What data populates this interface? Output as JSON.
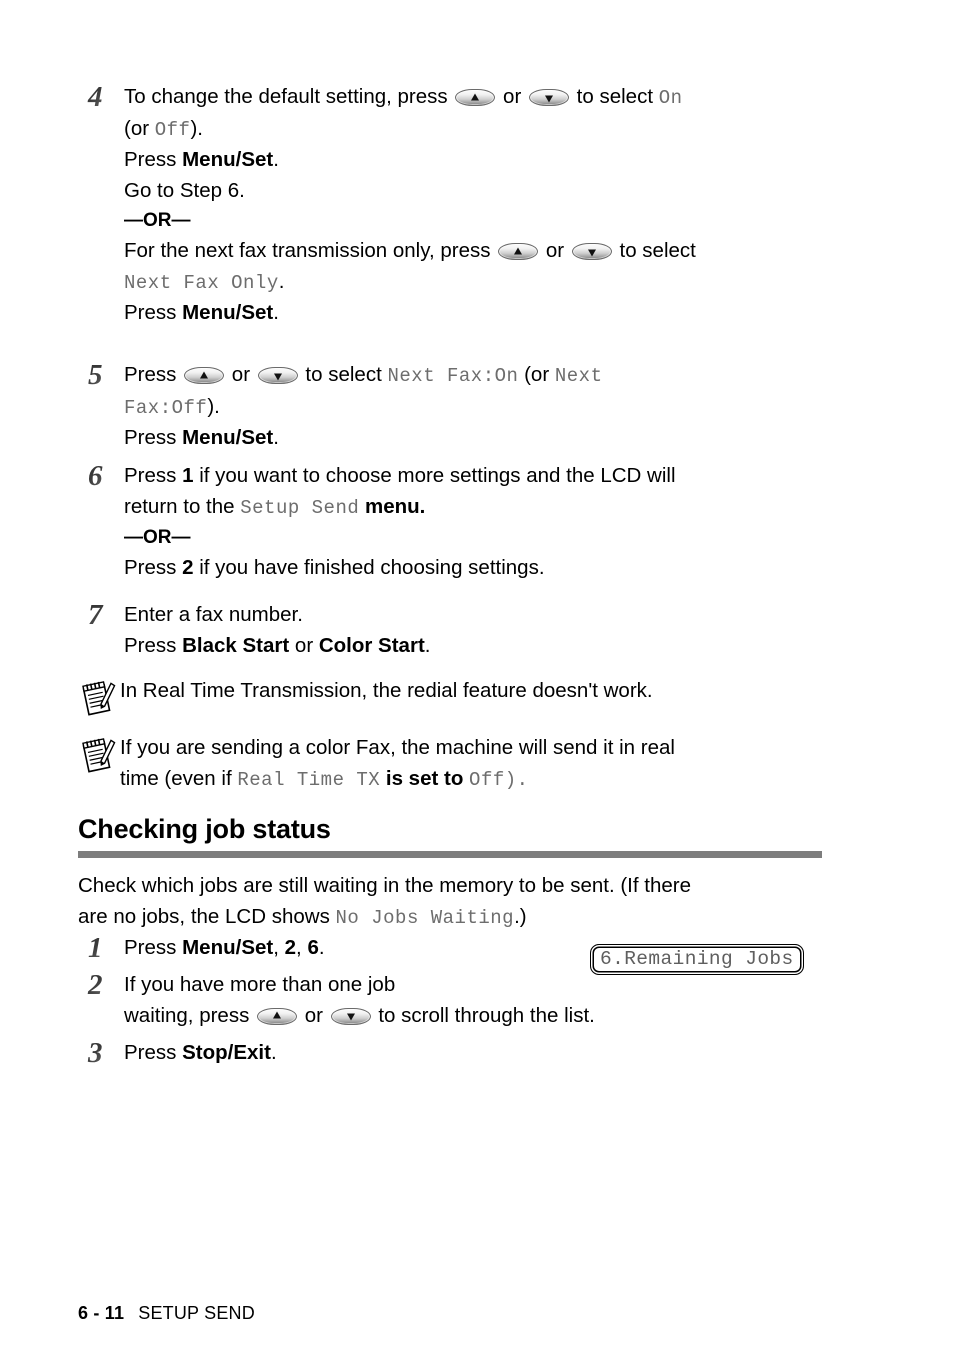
{
  "steps": [
    {
      "number": "4",
      "lines": [
        {
          "id": "s4l1",
          "pre": "To change the default setting, press ",
          "key1": "up",
          "mid": " or ",
          "key2": "down",
          "post": " to select ",
          "lcd_tail": "On"
        },
        {
          "id": "s4l2",
          "pre": "(or ",
          "lcd_mid": "Off",
          "post": ")."
        },
        {
          "id": "s4l3",
          "pre": "Press ",
          "bold": "Menu/Set",
          "post": "."
        },
        {
          "id": "s4l4",
          "pre": "Go to Step 6."
        },
        {
          "id": "s4or",
          "or_label": "—OR—"
        },
        {
          "id": "s4l5",
          "pre": "For the next fax transmission only, press ",
          "key1": "up",
          "mid": " or ",
          "key2": "down",
          "post": " to select"
        },
        {
          "id": "s4l6",
          "lcd_lead": "Next Fax Only",
          "post": "."
        },
        {
          "id": "s4l7",
          "pre": "Press ",
          "bold": "Menu/Set",
          "post": "."
        }
      ]
    },
    {
      "number": "5",
      "lines": [
        {
          "id": "s5l1",
          "pre": "Press ",
          "key1": "up",
          "mid": " or ",
          "key2": "down",
          "post": " to select ",
          "lcd_a": "Next Fax:On",
          "between": " (or ",
          "lcd_b": "Next"
        },
        {
          "id": "s5l2",
          "lcd_lead": "Fax:Off",
          "post": ")."
        },
        {
          "id": "s5l3",
          "pre": "Press ",
          "bold": "Menu/Set",
          "post": "."
        }
      ]
    },
    {
      "number": "6",
      "lines": [
        {
          "id": "s6l1",
          "pre": "Press ",
          "bold": "1",
          "post": " if you want to choose more settings and the LCD will"
        },
        {
          "id": "s6l2",
          "pre": "return to the ",
          "lcd_mid": "Setup Send",
          "bold_post": " menu."
        },
        {
          "id": "s6or",
          "or_label": "—OR—"
        },
        {
          "id": "s6l3",
          "pre": "Press ",
          "bold": "2",
          "post": " if you have finished choosing settings."
        }
      ]
    },
    {
      "number": "7",
      "lines": [
        {
          "id": "s7l1",
          "pre": "Enter a fax number."
        },
        {
          "id": "s7l2",
          "pre": "Press ",
          "bold": "Black Start",
          "mid_plain": " or ",
          "bold2": "Color Start",
          "post": "."
        }
      ]
    }
  ],
  "notes": [
    {
      "id": "note1",
      "icon": "notepad-pencil-icon",
      "text": "In Real Time Transmission, the redial feature doesn't work."
    },
    {
      "id": "note2",
      "icon": "notepad-pencil-icon",
      "line1_pre": "If you are sending a color Fax, the machine will send it in real",
      "line2_pre": "time (even if ",
      "line2_lcd": "Real Time TX",
      "line2_mid": " is set to ",
      "line2_lcd2": "Off",
      "line2_post": ")."
    }
  ],
  "section": {
    "heading": "Checking job status",
    "intro_line1": "Check which jobs are still waiting in the memory to be sent. (If there",
    "intro_line2_pre": "are no jobs, the LCD shows ",
    "intro_line2_lcd": "No Jobs Waiting",
    "intro_line2_post": ".)",
    "steps": [
      {
        "number": "1",
        "lines": [
          {
            "id": "c1l1",
            "pre": "Press ",
            "bold": "Menu/Set",
            "mid_plain": ", ",
            "bold2": "2",
            "mid_plain2": ", ",
            "bold3": "6",
            "post": "."
          }
        ]
      },
      {
        "number": "2",
        "lines": [
          {
            "id": "c2l1",
            "pre": "If you have more than one job"
          },
          {
            "id": "c2l2",
            "pre": "waiting, press ",
            "key1": "up",
            "mid": " or ",
            "key2": "down",
            "post": " to scroll through the list."
          }
        ]
      },
      {
        "number": "3",
        "lines": [
          {
            "id": "c3l1",
            "pre": "Press ",
            "bold": "Stop/Exit",
            "post": "."
          }
        ]
      }
    ]
  },
  "lcd_callout": {
    "text": "6.Remaining Jobs"
  },
  "footer": {
    "page": "6 - 11",
    "section_name": "SETUP SEND"
  },
  "colors": {
    "rule_gray": "#7d7d7d",
    "lcd_text_gray": "#6d6d6d",
    "body_text": "#000000"
  }
}
